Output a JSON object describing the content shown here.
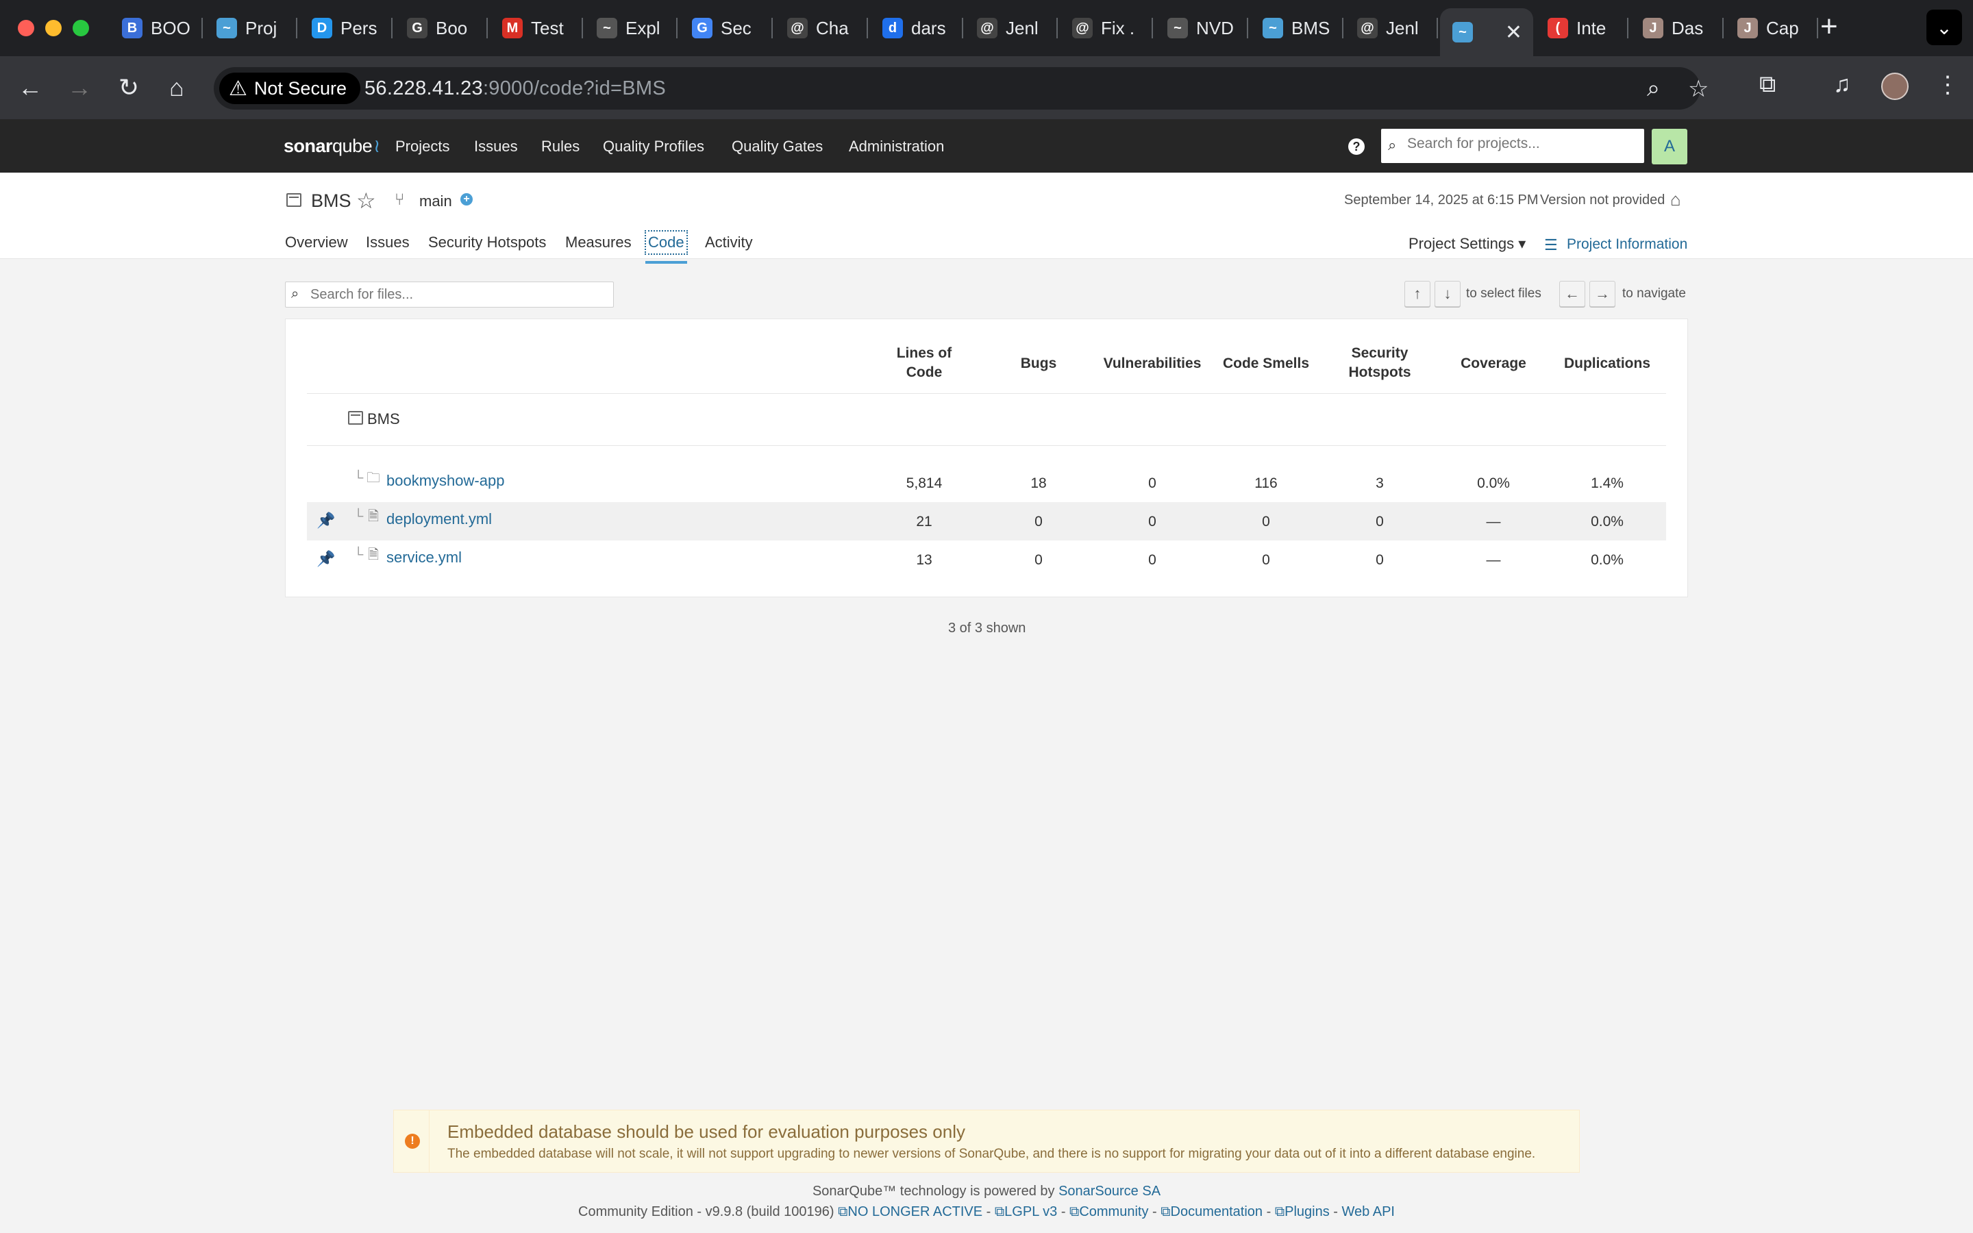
{
  "browser": {
    "tabs": [
      {
        "label": "BOO",
        "color": "#3b6fd8",
        "glyph": "B"
      },
      {
        "label": "Proj",
        "color": "#4b9fd5",
        "glyph": "~"
      },
      {
        "label": "Pers",
        "color": "#2496ed",
        "glyph": "D"
      },
      {
        "label": "Boo",
        "color": "#444",
        "glyph": "G"
      },
      {
        "label": "Test",
        "color": "#d93025",
        "glyph": "M"
      },
      {
        "label": "Expl",
        "color": "#555",
        "glyph": "~"
      },
      {
        "label": "Sec",
        "color": "#4285f4",
        "glyph": "G"
      },
      {
        "label": "Cha",
        "color": "#444",
        "glyph": "@"
      },
      {
        "label": "dars",
        "color": "#1f6feb",
        "glyph": "d"
      },
      {
        "label": "Jenl",
        "color": "#444",
        "glyph": "@"
      },
      {
        "label": "Fix .",
        "color": "#444",
        "glyph": "@"
      },
      {
        "label": "NVD",
        "color": "#555",
        "glyph": "~"
      },
      {
        "label": "BMS",
        "color": "#4b9fd5",
        "glyph": "~"
      },
      {
        "label": "Jenl",
        "color": "#444",
        "glyph": "@"
      },
      {
        "label": "",
        "color": "#4b9fd5",
        "glyph": "~"
      },
      {
        "label": "Inte",
        "color": "#e53935",
        "glyph": "("
      },
      {
        "label": "Das",
        "color": "#a1887f",
        "glyph": "J"
      },
      {
        "label": "Cap",
        "color": "#a1887f",
        "glyph": "J"
      }
    ],
    "security_label": "Not Secure",
    "url_host": "56.228.41.23",
    "url_rest": ":9000/code?id=BMS"
  },
  "sonar": {
    "logo_bold": "sonar",
    "logo_light": "qube",
    "menu": [
      "Projects",
      "Issues",
      "Rules",
      "Quality Profiles",
      "Quality Gates",
      "Administration"
    ],
    "search_placeholder": "Search for projects...",
    "user_initial": "A"
  },
  "project": {
    "name": "BMS",
    "branch": "main",
    "analysis_date": "September 14, 2025 at 6:15 PM",
    "version": "Version not provided",
    "tabs": [
      "Overview",
      "Issues",
      "Security Hotspots",
      "Measures",
      "Code",
      "Activity"
    ],
    "active_tab": "Code",
    "settings_label": "Project Settings",
    "info_label": "Project Information"
  },
  "code": {
    "search_placeholder": "Search for files...",
    "select_hint": "to select files",
    "navigate_hint": "to navigate",
    "columns": [
      "Lines of Code",
      "Bugs",
      "Vulnerabilities",
      "Code Smells",
      "Security Hotspots",
      "Coverage",
      "Duplications"
    ],
    "root": "BMS",
    "rows": [
      {
        "name": "bookmyshow-app",
        "type": "folder",
        "pinned": false,
        "loc": "5,814",
        "bugs": "18",
        "vulns": "0",
        "smells": "116",
        "hotspots": "3",
        "coverage": "0.0%",
        "dup": "1.4%"
      },
      {
        "name": "deployment.yml",
        "type": "file",
        "pinned": true,
        "loc": "21",
        "bugs": "0",
        "vulns": "0",
        "smells": "0",
        "hotspots": "0",
        "coverage": "—",
        "dup": "0.0%"
      },
      {
        "name": "service.yml",
        "type": "file",
        "pinned": true,
        "loc": "13",
        "bugs": "0",
        "vulns": "0",
        "smells": "0",
        "hotspots": "0",
        "coverage": "—",
        "dup": "0.0%"
      }
    ],
    "shown": "3 of 3 shown"
  },
  "footer": {
    "warning_title": "Embedded database should be used for evaluation purposes only",
    "warning_body": "The embedded database will not scale, it will not support upgrading to newer versions of SonarQube, and there is no support for migrating your data out of it into a different database engine.",
    "powered_prefix": "SonarQube™ technology is powered by ",
    "powered_link": "SonarSource SA",
    "edition": "Community Edition - v9.9.8 (build 100196)",
    "links": [
      "NO LONGER ACTIVE",
      "LGPL v3",
      "Community",
      "Documentation",
      "Plugins",
      "Web API"
    ]
  }
}
